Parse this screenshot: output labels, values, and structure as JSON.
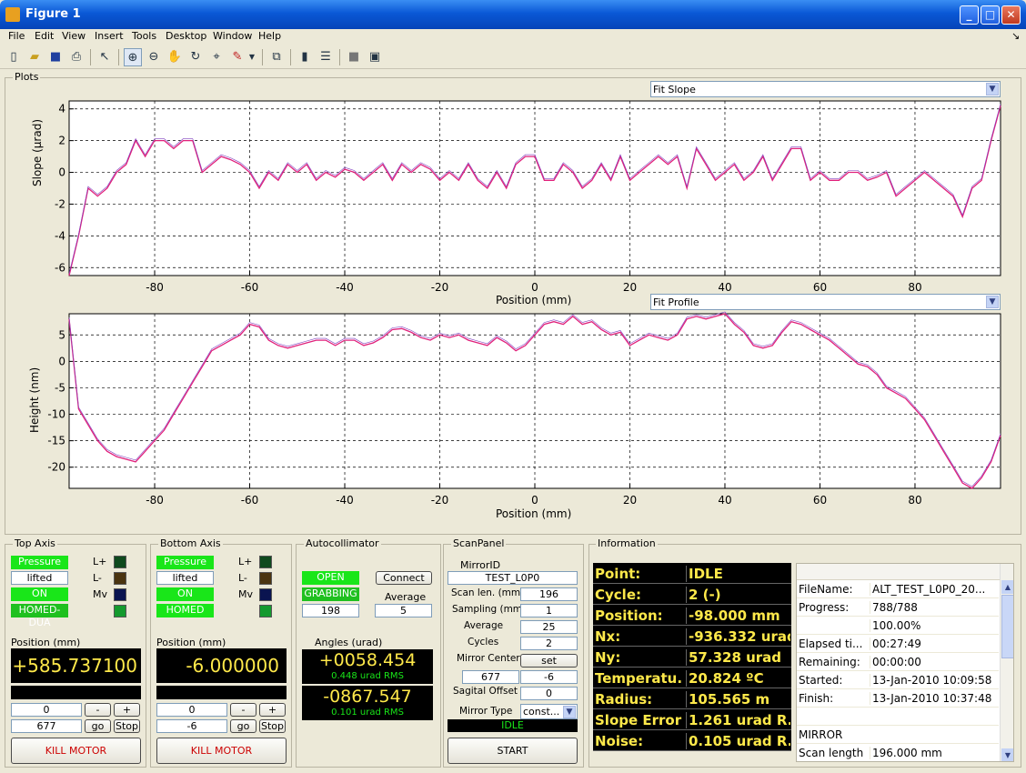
{
  "window": {
    "title": "Figure 1",
    "min": "_",
    "max": "□",
    "close": "✕"
  },
  "menu": [
    "File",
    "Edit",
    "View",
    "Insert",
    "Tools",
    "Desktop",
    "Window",
    "Help"
  ],
  "menu_right": "↘",
  "plots_panel": {
    "label": "Plots"
  },
  "slope_plot": {
    "dropdown": "Fit Slope",
    "ylabel": "Slope (µrad)",
    "xlabel": "Position (mm)",
    "yticks": [
      "4",
      "2",
      "0",
      "-2",
      "-4",
      "-6"
    ],
    "xticks": [
      "-80",
      "-60",
      "-40",
      "-20",
      "0",
      "20",
      "40",
      "60",
      "80"
    ]
  },
  "height_plot": {
    "dropdown": "Fit Profile",
    "ylabel": "Height (nm)",
    "xlabel": "Position (mm)",
    "yticks": [
      "5",
      "0",
      "-5",
      "-10",
      "-15",
      "-20"
    ],
    "xticks": [
      "-80",
      "-60",
      "-40",
      "-20",
      "0",
      "20",
      "40",
      "60",
      "80"
    ]
  },
  "chart_data": [
    {
      "type": "line",
      "xlabel": "Position (mm)",
      "ylabel": "Slope (µrad)",
      "xlim": [
        -98,
        98
      ],
      "ylim": [
        -6.5,
        4.5
      ],
      "grid": true,
      "series": [
        {
          "color": "#e0207a",
          "x": [
            -98,
            -96,
            -94,
            -92,
            -90,
            -88,
            -86,
            -84,
            -82,
            -80,
            -78,
            -76,
            -74,
            -72,
            -70,
            -68,
            -66,
            -64,
            -62,
            -60,
            -58,
            -56,
            -54,
            -52,
            -50,
            -48,
            -46,
            -44,
            -42,
            -40,
            -38,
            -36,
            -34,
            -32,
            -30,
            -28,
            -26,
            -24,
            -22,
            -20,
            -18,
            -16,
            -14,
            -12,
            -10,
            -8,
            -6,
            -4,
            -2,
            0,
            2,
            4,
            6,
            8,
            10,
            12,
            14,
            16,
            18,
            20,
            22,
            24,
            26,
            28,
            30,
            32,
            34,
            36,
            38,
            40,
            42,
            44,
            46,
            48,
            50,
            52,
            54,
            56,
            58,
            60,
            62,
            64,
            66,
            68,
            70,
            72,
            74,
            76,
            78,
            80,
            82,
            84,
            86,
            88,
            90,
            92,
            94,
            96,
            98
          ],
          "y": [
            -6.5,
            -4,
            -1,
            -1.5,
            -1,
            0,
            0.5,
            2,
            1,
            2,
            2,
            1.5,
            2,
            2,
            0,
            0.5,
            1,
            0.8,
            0.5,
            0,
            -1,
            0,
            -0.5,
            0.5,
            0,
            0.5,
            -0.5,
            0,
            -0.3,
            0.2,
            0,
            -0.5,
            0,
            0.5,
            -0.5,
            0.5,
            0,
            0.5,
            0.2,
            -0.5,
            0,
            -0.5,
            0.5,
            -0.5,
            -1,
            0,
            -1,
            0.5,
            1,
            1,
            -0.5,
            -0.5,
            0.5,
            0,
            -1,
            -0.5,
            0.5,
            -0.5,
            1,
            -0.5,
            0,
            0.5,
            1,
            0.5,
            1,
            -1,
            1.5,
            0.5,
            -0.5,
            0,
            0.5,
            -0.5,
            0,
            1,
            -0.5,
            0.5,
            1.5,
            1.5,
            -0.5,
            0,
            -0.5,
            -0.5,
            0,
            0,
            -0.5,
            -0.3,
            0,
            -1.5,
            -1,
            -0.5,
            0,
            -0.5,
            -1,
            -1.5,
            -2.8,
            -1,
            -0.5,
            2,
            4.2
          ]
        }
      ]
    },
    {
      "type": "line",
      "xlabel": "Position (mm)",
      "ylabel": "Height (nm)",
      "xlim": [
        -98,
        98
      ],
      "ylim": [
        -24,
        9
      ],
      "grid": true,
      "series": [
        {
          "color": "#e0207a",
          "x": [
            -98,
            -96,
            -94,
            -92,
            -90,
            -88,
            -86,
            -84,
            -82,
            -80,
            -78,
            -76,
            -74,
            -72,
            -70,
            -68,
            -66,
            -64,
            -62,
            -60,
            -58,
            -56,
            -54,
            -52,
            -50,
            -48,
            -46,
            -44,
            -42,
            -40,
            -38,
            -36,
            -34,
            -32,
            -30,
            -28,
            -26,
            -24,
            -22,
            -20,
            -18,
            -16,
            -14,
            -12,
            -10,
            -8,
            -6,
            -4,
            -2,
            0,
            2,
            4,
            6,
            8,
            10,
            12,
            14,
            16,
            18,
            20,
            22,
            24,
            26,
            28,
            30,
            32,
            34,
            36,
            38,
            40,
            42,
            44,
            46,
            48,
            50,
            52,
            54,
            56,
            58,
            60,
            62,
            64,
            66,
            68,
            70,
            72,
            74,
            76,
            78,
            80,
            82,
            84,
            86,
            88,
            90,
            92,
            94,
            96,
            98
          ],
          "y": [
            8,
            -9,
            -12,
            -15,
            -17,
            -18,
            -18.5,
            -19,
            -17,
            -15,
            -13,
            -10,
            -7,
            -4,
            -1,
            2,
            3,
            4,
            5,
            7,
            6.5,
            4,
            3,
            2.5,
            3,
            3.5,
            4,
            4,
            3,
            4,
            4,
            3,
            3.5,
            4.5,
            6,
            6.2,
            5.5,
            4.5,
            4,
            5,
            4.5,
            5,
            4,
            3.5,
            3,
            4.5,
            3.5,
            2,
            3,
            5,
            7,
            7.5,
            7,
            8.5,
            7,
            7.5,
            6,
            5,
            5.5,
            3,
            4,
            5,
            4.5,
            4,
            5,
            8,
            8.5,
            8,
            8.5,
            9,
            7,
            5.5,
            3,
            2.5,
            3,
            5.5,
            7.5,
            7,
            6,
            5,
            4,
            2.5,
            1,
            -0.5,
            -1,
            -2.5,
            -5,
            -6,
            -7,
            -9,
            -11,
            -14,
            -17,
            -20,
            -23,
            -24,
            -22,
            -19,
            -14
          ]
        }
      ]
    }
  ],
  "top_axis": {
    "label": "Top Axis",
    "status": [
      "Pressure",
      "lifted",
      "ON",
      "HOMED-DUA"
    ],
    "leds": [
      "L+",
      "L-",
      "Mv"
    ],
    "pos_label": "Position (mm)",
    "pos_value": "+585.737100",
    "step": "0",
    "minus": "-",
    "plus": "+",
    "target": "677",
    "go": "go",
    "stop": "Stop",
    "kill": "KILL MOTOR"
  },
  "bottom_axis": {
    "label": "Bottom Axis",
    "status": [
      "Pressure",
      "lifted",
      "ON",
      "HOMED"
    ],
    "leds": [
      "L+",
      "L-",
      "Mv"
    ],
    "pos_label": "Position (mm)",
    "pos_value": "-6.000000",
    "step": "0",
    "minus": "-",
    "plus": "+",
    "target": "-6",
    "go": "go",
    "stop": "Stop",
    "kill": "KILL MOTOR"
  },
  "autocollimator": {
    "label": "Autocollimator",
    "open": "OPEN",
    "grabbing": "GRABBING",
    "connect": "Connect",
    "average_label": "Average",
    "frames": "198",
    "average": "5",
    "angles_label": "Angles (urad)",
    "angle1": "+0058.454",
    "rms1": "0.448 urad RMS",
    "angle2": "-0867.547",
    "rms2": "0.101 urad RMS"
  },
  "scanpanel": {
    "label": "ScanPanel",
    "mirror_id_label": "MirrorID",
    "mirror_id": "TEST_L0P0",
    "rows": [
      {
        "label": "Scan len. (mm)",
        "value": "196"
      },
      {
        "label": "Sampling (mm)",
        "value": "1"
      },
      {
        "label": "Average",
        "value": "25"
      },
      {
        "label": "Cycles",
        "value": "2"
      }
    ],
    "mirror_center_label": "Mirror Center",
    "set": "set",
    "center_x": "677",
    "center_y": "-6",
    "sagital_label": "Sagital Offset",
    "sagital": "0",
    "mirror_type_label": "Mirror Type",
    "mirror_type": "const...",
    "state": "IDLE",
    "start": "START"
  },
  "information": {
    "label": "Information",
    "status": [
      {
        "k": "Point:",
        "v": "IDLE"
      },
      {
        "k": "Cycle:",
        "v": "2 (-)"
      },
      {
        "k": "Position:",
        "v": "-98.000 mm"
      },
      {
        "k": "Nx:",
        "v": "-936.332 urad"
      },
      {
        "k": "Ny:",
        "v": "57.328 urad"
      },
      {
        "k": "Temperatu...",
        "v": "20.824 ºC"
      },
      {
        "k": "Radius:",
        "v": "105.565 m"
      },
      {
        "k": "Slope Error:",
        "v": "1.261 urad R..."
      },
      {
        "k": "Noise:",
        "v": "0.105 urad R..."
      }
    ],
    "table": [
      {
        "k": "FileName:",
        "v": "ALT_TEST_L0P0_20..."
      },
      {
        "k": "Progress:",
        "v": "788/788"
      },
      {
        "k": "",
        "v": "100.00%"
      },
      {
        "k": "Elapsed ti...",
        "v": "00:27:49"
      },
      {
        "k": "Remaining:",
        "v": "00:00:00"
      },
      {
        "k": "Started:",
        "v": "13-Jan-2010 10:09:58"
      },
      {
        "k": "Finish:",
        "v": "13-Jan-2010 10:37:48"
      },
      {
        "k": "",
        "v": ""
      },
      {
        "k": "MIRROR",
        "v": ""
      },
      {
        "k": "Scan length",
        "v": "196.000 mm"
      }
    ]
  }
}
